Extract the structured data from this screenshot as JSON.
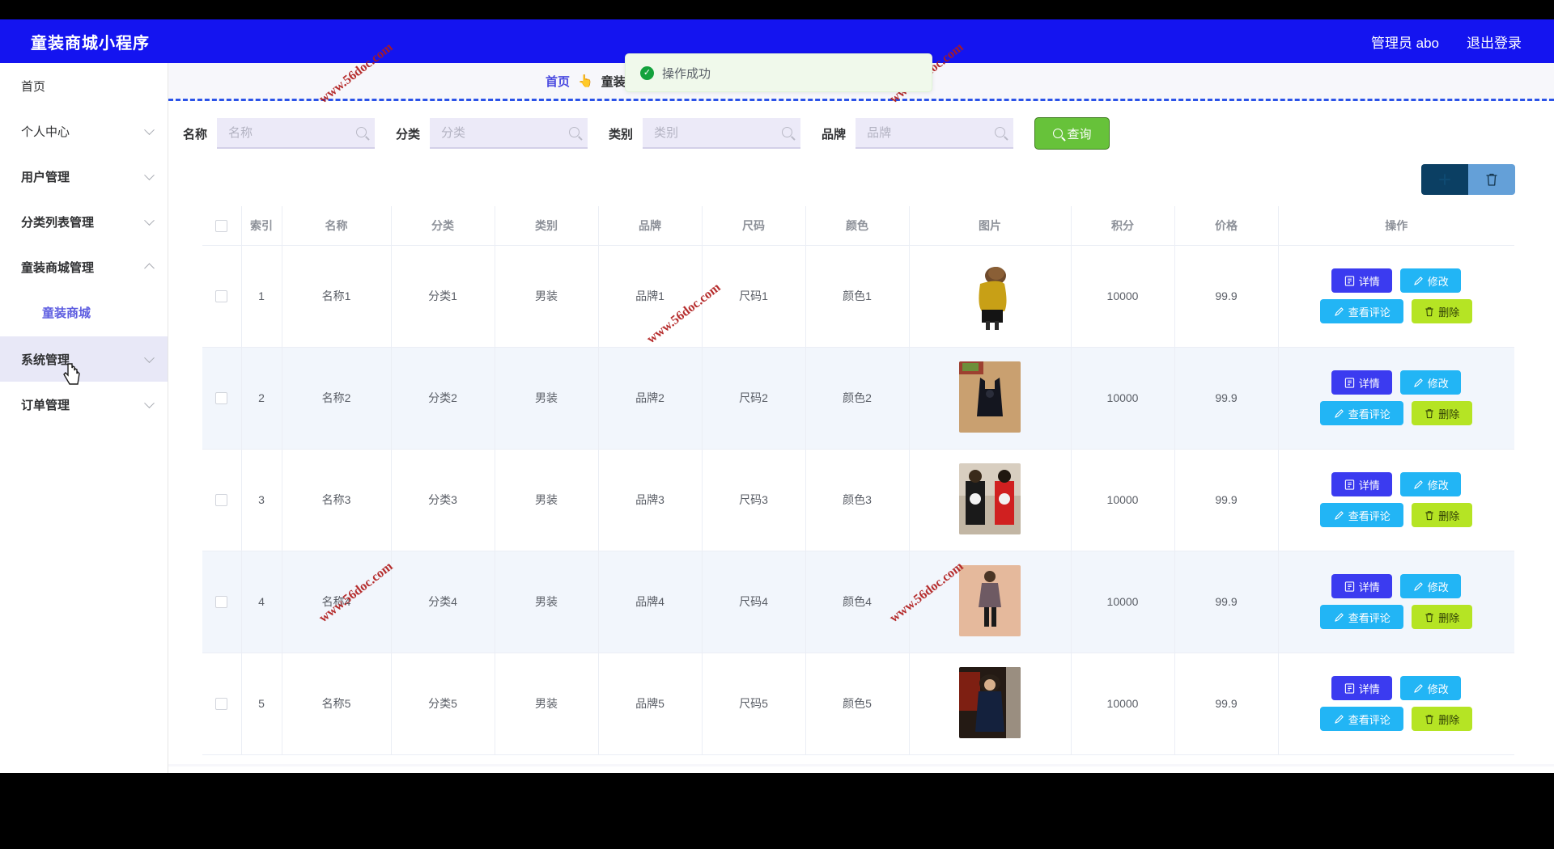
{
  "header": {
    "brand": "童装商城小程序",
    "admin_label": "管理员 abo",
    "logout_label": "退出登录"
  },
  "toast": {
    "message": "操作成功",
    "icon": "check-circle-icon",
    "color": "#13a23c"
  },
  "sidebar": {
    "items": [
      {
        "label": "首页",
        "expandable": false,
        "bold": false
      },
      {
        "label": "个人中心",
        "expandable": true,
        "bold": false
      },
      {
        "label": "用户管理",
        "expandable": true,
        "bold": true
      },
      {
        "label": "分类列表管理",
        "expandable": true,
        "bold": true
      },
      {
        "label": "童装商城管理",
        "expandable": true,
        "bold": true,
        "expanded": true
      },
      {
        "label": "系统管理",
        "expandable": true,
        "bold": true,
        "highlighted": true
      },
      {
        "label": "订单管理",
        "expandable": true,
        "bold": true
      }
    ],
    "sub_item": "童装商城"
  },
  "breadcrumb": {
    "home": "首页",
    "separator": "👆",
    "current": "童装商城"
  },
  "filters": {
    "fields": [
      {
        "label": "名称",
        "placeholder": "名称",
        "value": "",
        "icon": "search-icon"
      },
      {
        "label": "分类",
        "placeholder": "分类",
        "value": "",
        "icon": "search-icon"
      },
      {
        "label": "类别",
        "placeholder": "类别",
        "value": "",
        "icon": "search-icon"
      },
      {
        "label": "品牌",
        "placeholder": "品牌",
        "value": "",
        "icon": "search-icon"
      }
    ],
    "query_button": "查询",
    "query_color": "#67c23a"
  },
  "toolbar": {
    "add_icon": "plus-icon",
    "add_color": "#0b3f63",
    "delete_icon": "trash-icon",
    "delete_color": "#64a0d8"
  },
  "table": {
    "columns": [
      "",
      "索引",
      "名称",
      "分类",
      "类别",
      "品牌",
      "尺码",
      "颜色",
      "图片",
      "积分",
      "价格",
      "操作"
    ],
    "rows": [
      {
        "index": "1",
        "name": "名称1",
        "category": "分类1",
        "type": "男装",
        "brand": "品牌1",
        "size": "尺码1",
        "color": "颜色1",
        "image": "yellow-puffer-jacket-girl",
        "points": "10000",
        "price": "99.9"
      },
      {
        "index": "2",
        "name": "名称2",
        "category": "分类2",
        "type": "男装",
        "brand": "品牌2",
        "size": "尺码2",
        "color": "颜色2",
        "image": "black-overall-dress",
        "points": "10000",
        "price": "99.9"
      },
      {
        "index": "3",
        "name": "名称3",
        "category": "分类3",
        "type": "男装",
        "brand": "品牌3",
        "size": "尺码3",
        "color": "颜色3",
        "image": "panda-outfit-two-kids",
        "points": "10000",
        "price": "99.9"
      },
      {
        "index": "4",
        "name": "名称4",
        "category": "分类4",
        "type": "男装",
        "brand": "品牌4",
        "size": "尺码4",
        "color": "颜色4",
        "image": "girl-patterned-coat",
        "points": "10000",
        "price": "99.9"
      },
      {
        "index": "5",
        "name": "名称5",
        "category": "分类5",
        "type": "男装",
        "brand": "品牌5",
        "size": "尺码5",
        "color": "颜色5",
        "image": "navy-hooded-parka",
        "points": "10000",
        "price": "99.9"
      }
    ],
    "actions": {
      "detail": "详情",
      "edit": "修改",
      "comment": "查看评论",
      "remove": "删除",
      "detail_color": "#3b3bf0",
      "edit_color": "#22b5f5",
      "comment_color": "#22b5f5",
      "remove_color": "#b5e424"
    }
  },
  "watermark": {
    "text": "www.56doc.com"
  }
}
